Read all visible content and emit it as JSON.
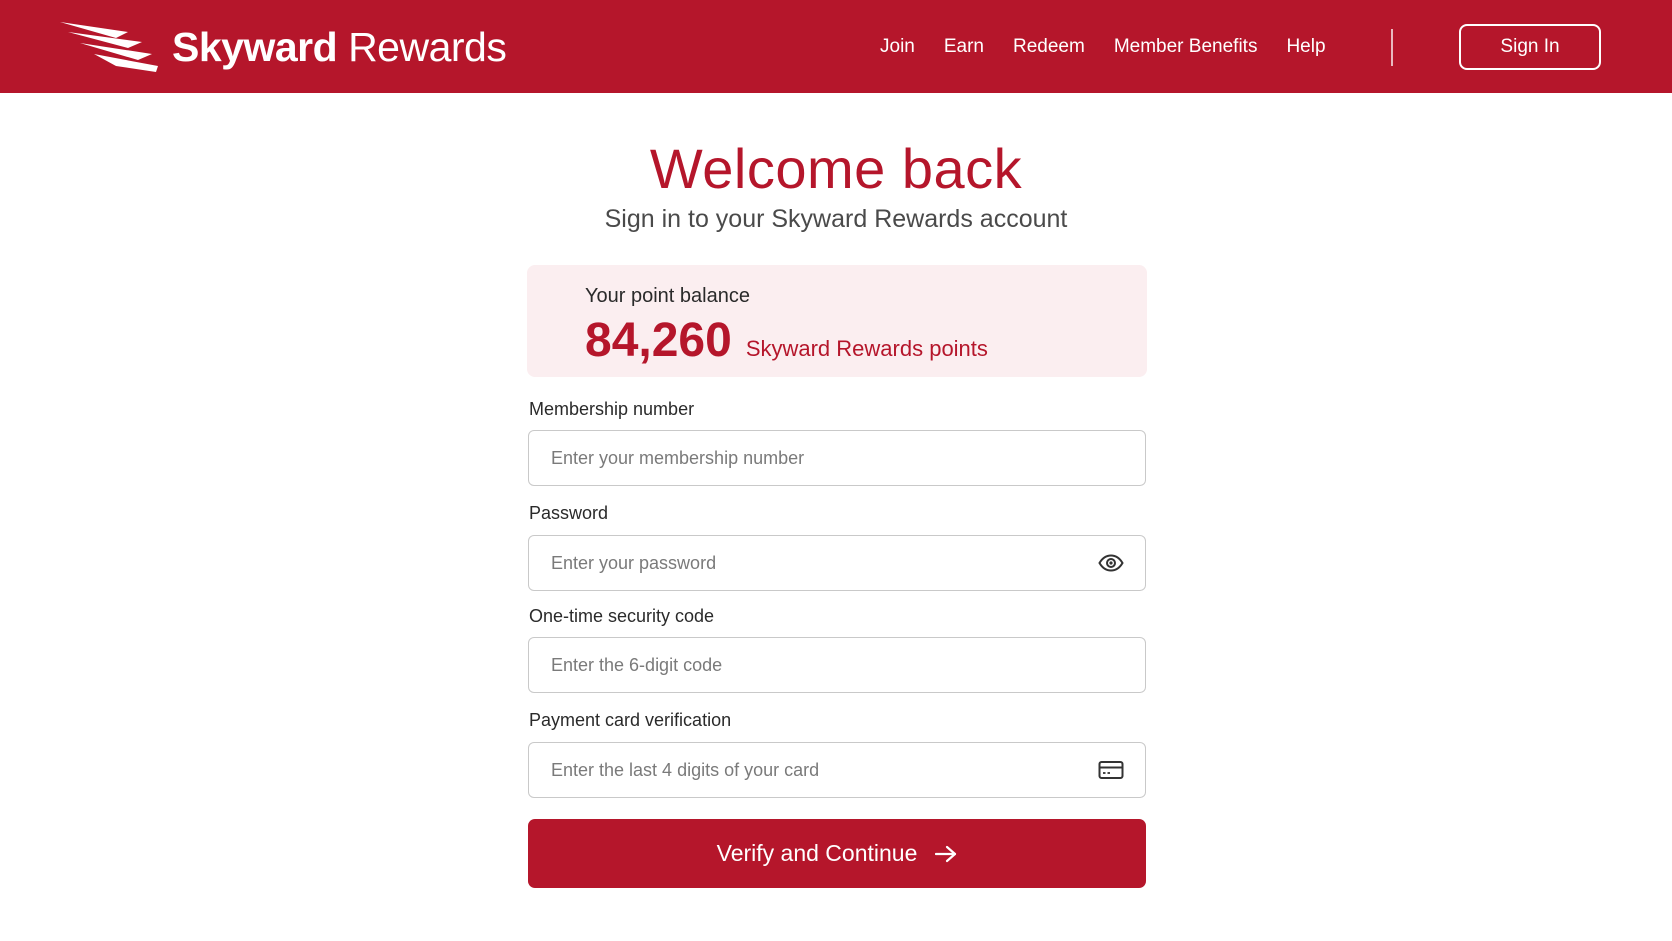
{
  "brand": {
    "name_bold": "Skyward",
    "name_light": "Rewards",
    "primary_color": "#b5162b"
  },
  "nav": {
    "items": [
      "Join",
      "Earn",
      "Redeem",
      "Member Benefits",
      "Help"
    ],
    "sign_in_label": "Sign In"
  },
  "main": {
    "title": "Welcome back",
    "subtitle": "Sign in to your Skyward Rewards account"
  },
  "balance": {
    "label": "Your point balance",
    "points": "84,260",
    "unit": "Skyward Rewards points"
  },
  "form": {
    "membership": {
      "label": "Membership number",
      "placeholder": "Enter your membership number",
      "value": ""
    },
    "password": {
      "label": "Password",
      "placeholder": "Enter your password",
      "value": "",
      "icon": "eye-icon"
    },
    "security_code": {
      "label": "One-time security code",
      "placeholder": "Enter the 6-digit code",
      "value": ""
    },
    "card_verification": {
      "label": "Payment card verification",
      "placeholder": "Enter the last 4 digits of your card",
      "value": "",
      "icon": "credit-card-icon"
    },
    "submit_label": "Verify and Continue",
    "submit_icon": "arrow-right-icon"
  }
}
